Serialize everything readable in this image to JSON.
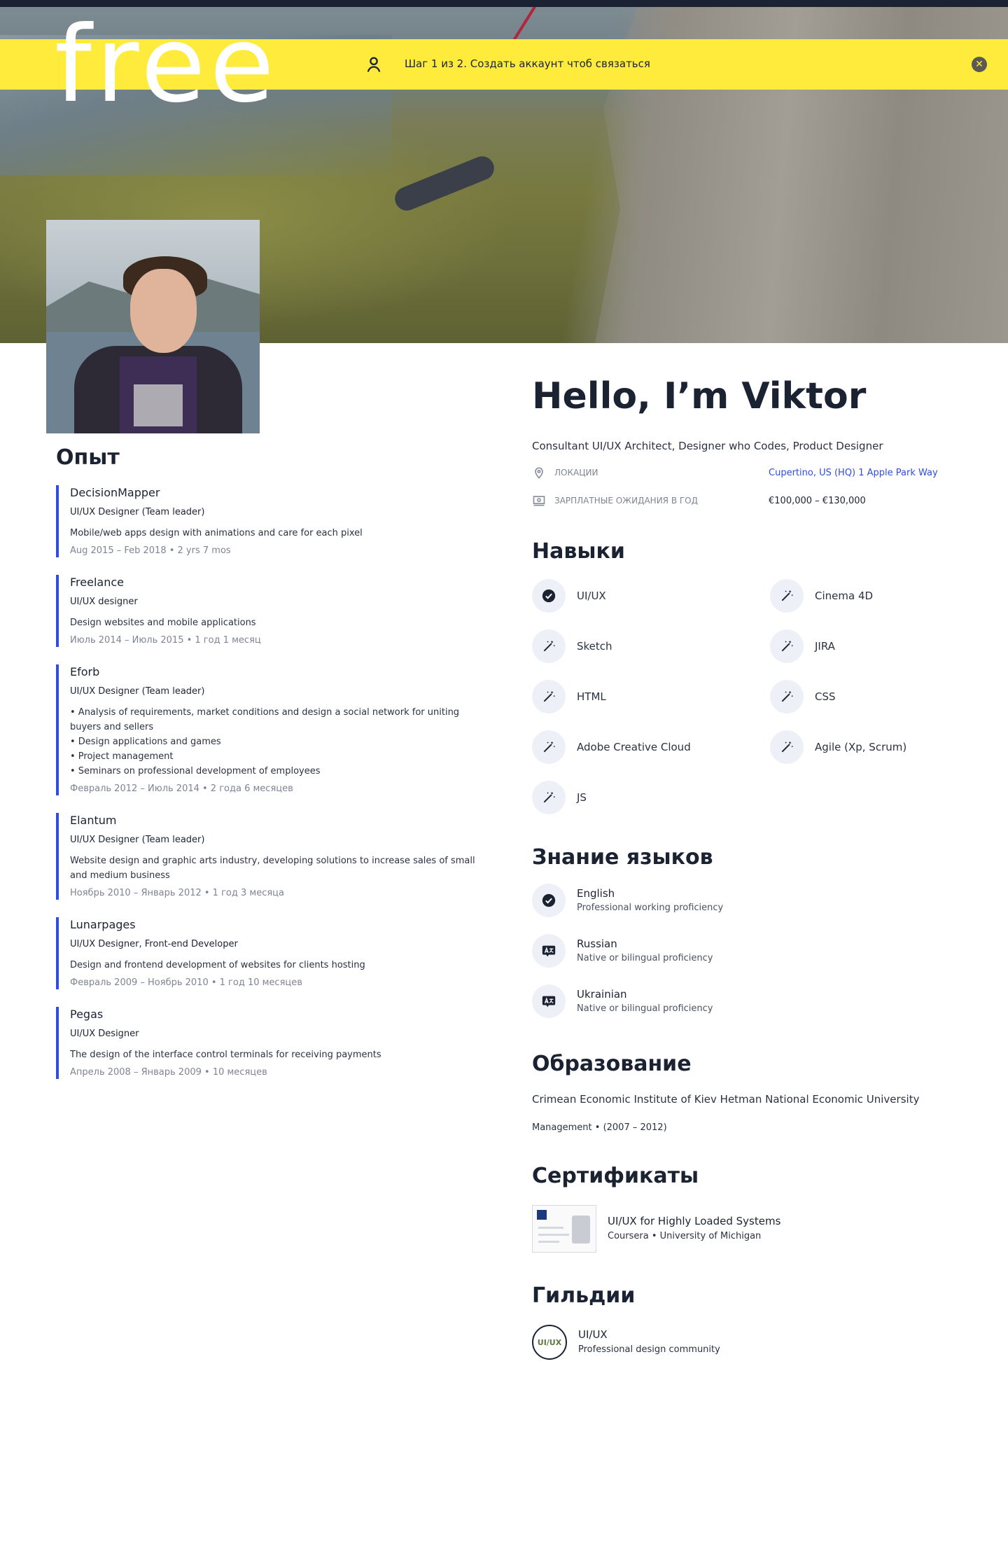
{
  "brand": {
    "name": "free"
  },
  "notice": {
    "text": "Шаг 1 из 2. Создать аккаунт чтоб связаться"
  },
  "profile": {
    "greeting": "Hello, I’m Viktor",
    "title": "Consultant UI/UX Architect, Designer who Codes, Product Designer",
    "location_label": "ЛОКАЦИИ",
    "location_value": "Cupertino, US (HQ) 1 Apple Park Way",
    "salary_label": "ЗАРПЛАТНЫЕ ОЖИДАНИЯ  В ГОД",
    "salary_value": "€100,000 – €130,000"
  },
  "experience": {
    "heading": "Опыт",
    "jobs": [
      {
        "company": "DecisionMapper",
        "role": "UI/UX Designer (Team leader)",
        "desc": [
          "Mobile/web apps design with animations and care for each pixel"
        ],
        "period": "Aug 2015 – Feb 2018 • 2 yrs 7 mos"
      },
      {
        "company": "Freelance",
        "role": "UI/UX designer",
        "desc": [
          "Design websites and mobile applications"
        ],
        "period": "Июль 2014 – Июль 2015 • 1 год 1 месяц"
      },
      {
        "company": "Eforb",
        "role": "UI/UX Designer (Team leader)",
        "desc": [
          "• Analysis of requirements, market conditions and design a social network for uniting buyers and sellers",
          "• Design applications and games",
          "• Project management",
          "• Seminars on professional development of employees"
        ],
        "period": "Февраль 2012 – Июль 2014 • 2 года 6 месяцев"
      },
      {
        "company": "Elantum",
        "role": "UI/UX Designer (Team leader)",
        "desc": [
          "Website design and graphic arts industry, developing solutions to increase sales of small and medium business"
        ],
        "period": "Ноябрь 2010 – Январь 2012 • 1 год 3 месяца"
      },
      {
        "company": "Lunarpages",
        "role": "UI/UX Designer, Front-end Developer",
        "desc": [
          "Design and frontend development of websites for clients hosting"
        ],
        "period": "Февраль 2009 – Ноябрь 2010 • 1 год 10 месяцев"
      },
      {
        "company": "Pegas",
        "role": "UI/UX Designer",
        "desc": [
          "The design of the interface control terminals for receiving payments"
        ],
        "period": "Апрель 2008 – Январь 2009 • 10 месяцев"
      }
    ]
  },
  "skills": {
    "heading": "Навыки",
    "items": [
      {
        "name": "UI/UX",
        "icon": "check-icon"
      },
      {
        "name": "Cinema 4D",
        "icon": "magic-wand-icon"
      },
      {
        "name": "Sketch",
        "icon": "magic-wand-icon"
      },
      {
        "name": "JIRA",
        "icon": "magic-wand-icon"
      },
      {
        "name": "HTML",
        "icon": "magic-wand-icon"
      },
      {
        "name": "CSS",
        "icon": "magic-wand-icon"
      },
      {
        "name": "Adobe Creative Cloud",
        "icon": "magic-wand-icon"
      },
      {
        "name": "Agile (Xp, Scrum)",
        "icon": "magic-wand-icon"
      },
      {
        "name": "JS",
        "icon": "magic-wand-icon"
      }
    ]
  },
  "languages": {
    "heading": "Знание языков",
    "items": [
      {
        "name": "English",
        "level": "Professional working proficiency",
        "icon": "check-icon"
      },
      {
        "name": "Russian",
        "level": "Native or bilingual proficiency",
        "icon": "translate-icon"
      },
      {
        "name": "Ukrainian",
        "level": "Native or bilingual proficiency",
        "icon": "translate-icon"
      }
    ]
  },
  "education": {
    "heading": "Образование",
    "school": "Crimean Economic Institute of Kiev Hetman National Economic University",
    "degree": "Management • (2007 – 2012)"
  },
  "certificates": {
    "heading": "Сертификаты",
    "items": [
      {
        "name": "UI/UX for Highly Loaded Systems",
        "source": "Coursera • University of Michigan"
      }
    ]
  },
  "guilds": {
    "heading": "Гильдии",
    "items": [
      {
        "name": "UI/UX",
        "desc": "Professional design community",
        "logo_text": "UI/UX"
      }
    ]
  },
  "colors": {
    "accent": "#2d4ee0",
    "notice": "#ffeb3b",
    "text": "#1b2333"
  }
}
